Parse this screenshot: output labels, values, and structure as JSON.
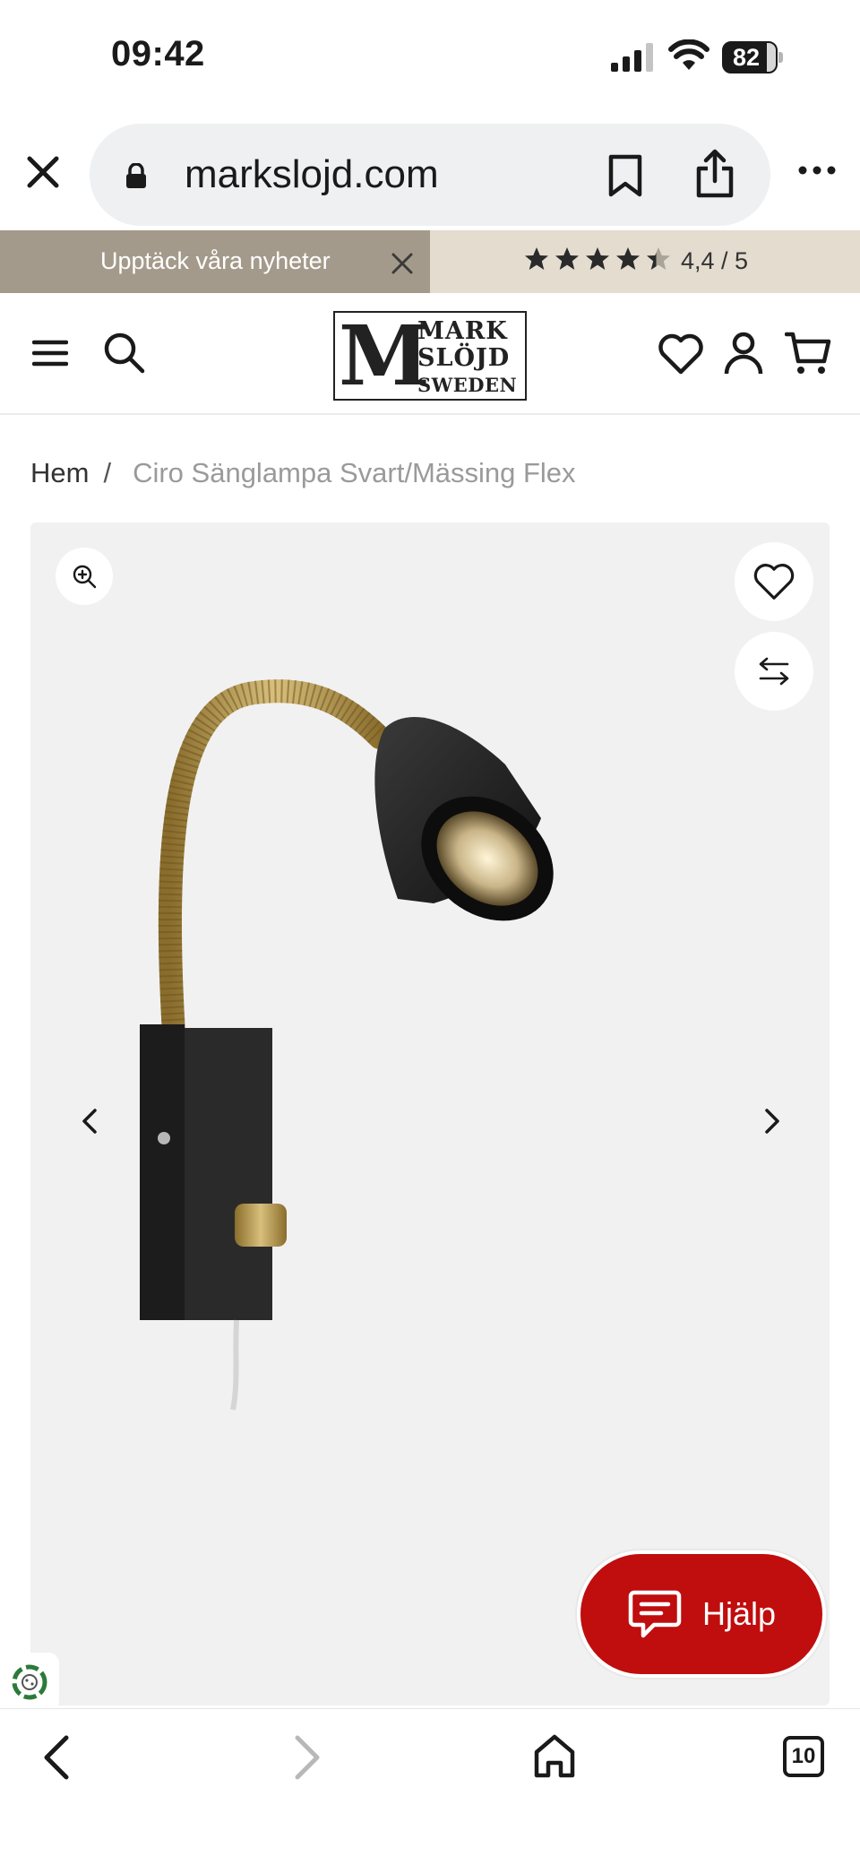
{
  "status_bar": {
    "time": "09:42",
    "battery_level": 82,
    "battery_label": "82"
  },
  "browser": {
    "url": "markslojd.com",
    "tab_count": "10"
  },
  "promo": {
    "left_text": "Upptäck våra nyheter",
    "rating_text": "4,4 / 5",
    "rating_value": 4.4,
    "rating_max": 5,
    "bar_left_color": "#a49a8b",
    "bar_right_color": "#e3dccf"
  },
  "header": {
    "logo_letter": "M",
    "logo_lines": [
      "MARK",
      "SLÖJD",
      "SWEDEN"
    ]
  },
  "breadcrumb": {
    "home": "Hem",
    "separator": "/",
    "current": "Ciro Sänglampa Svart/Mässing Flex"
  },
  "help": {
    "label": "Hjälp",
    "color": "#c00d0d"
  },
  "icons": {
    "close": "close-icon",
    "lock": "lock-icon",
    "bookmark": "bookmark-icon",
    "share": "share-icon",
    "more": "more-icon",
    "menu": "hamburger-icon",
    "search": "search-icon",
    "wishlist": "heart-icon",
    "account": "user-icon",
    "cart": "cart-icon",
    "zoom": "zoom-icon",
    "compare": "compare-icon",
    "prev": "chevron-left-icon",
    "next": "chevron-right-icon",
    "chat": "chat-icon",
    "home": "home-icon"
  }
}
